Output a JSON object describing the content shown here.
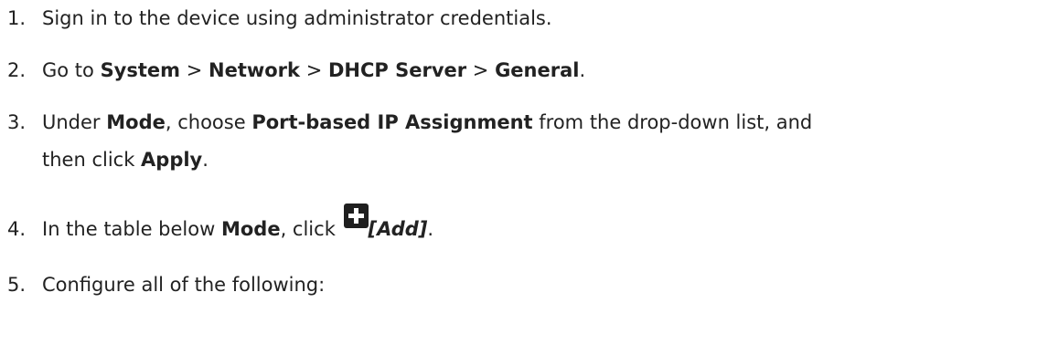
{
  "steps": [
    {
      "number": "1.",
      "text": "Sign in to the device using administrator credentials."
    },
    {
      "number": "2.",
      "prefix": "Go to ",
      "path": [
        "System",
        "Network",
        "DHCP Server",
        "General"
      ],
      "separator": " > ",
      "suffix": "."
    },
    {
      "number": "3.",
      "t1": "Under ",
      "b1": "Mode",
      "t2": ", choose ",
      "b2": "Port-based IP Assignment",
      "t3": " from the drop-down list, and",
      "t4": "then click ",
      "b3": "Apply",
      "t5": "."
    },
    {
      "number": "4.",
      "t1": "In the table below ",
      "b1": "Mode",
      "t2": ", click ",
      "add_label": "[Add]",
      "t3": "."
    },
    {
      "number": "5.",
      "text": "Configure all of the following:"
    }
  ],
  "icons": {
    "add": "plus-icon"
  },
  "colors": {
    "text": "#222222",
    "icon_bg": "#1f1f1f"
  }
}
